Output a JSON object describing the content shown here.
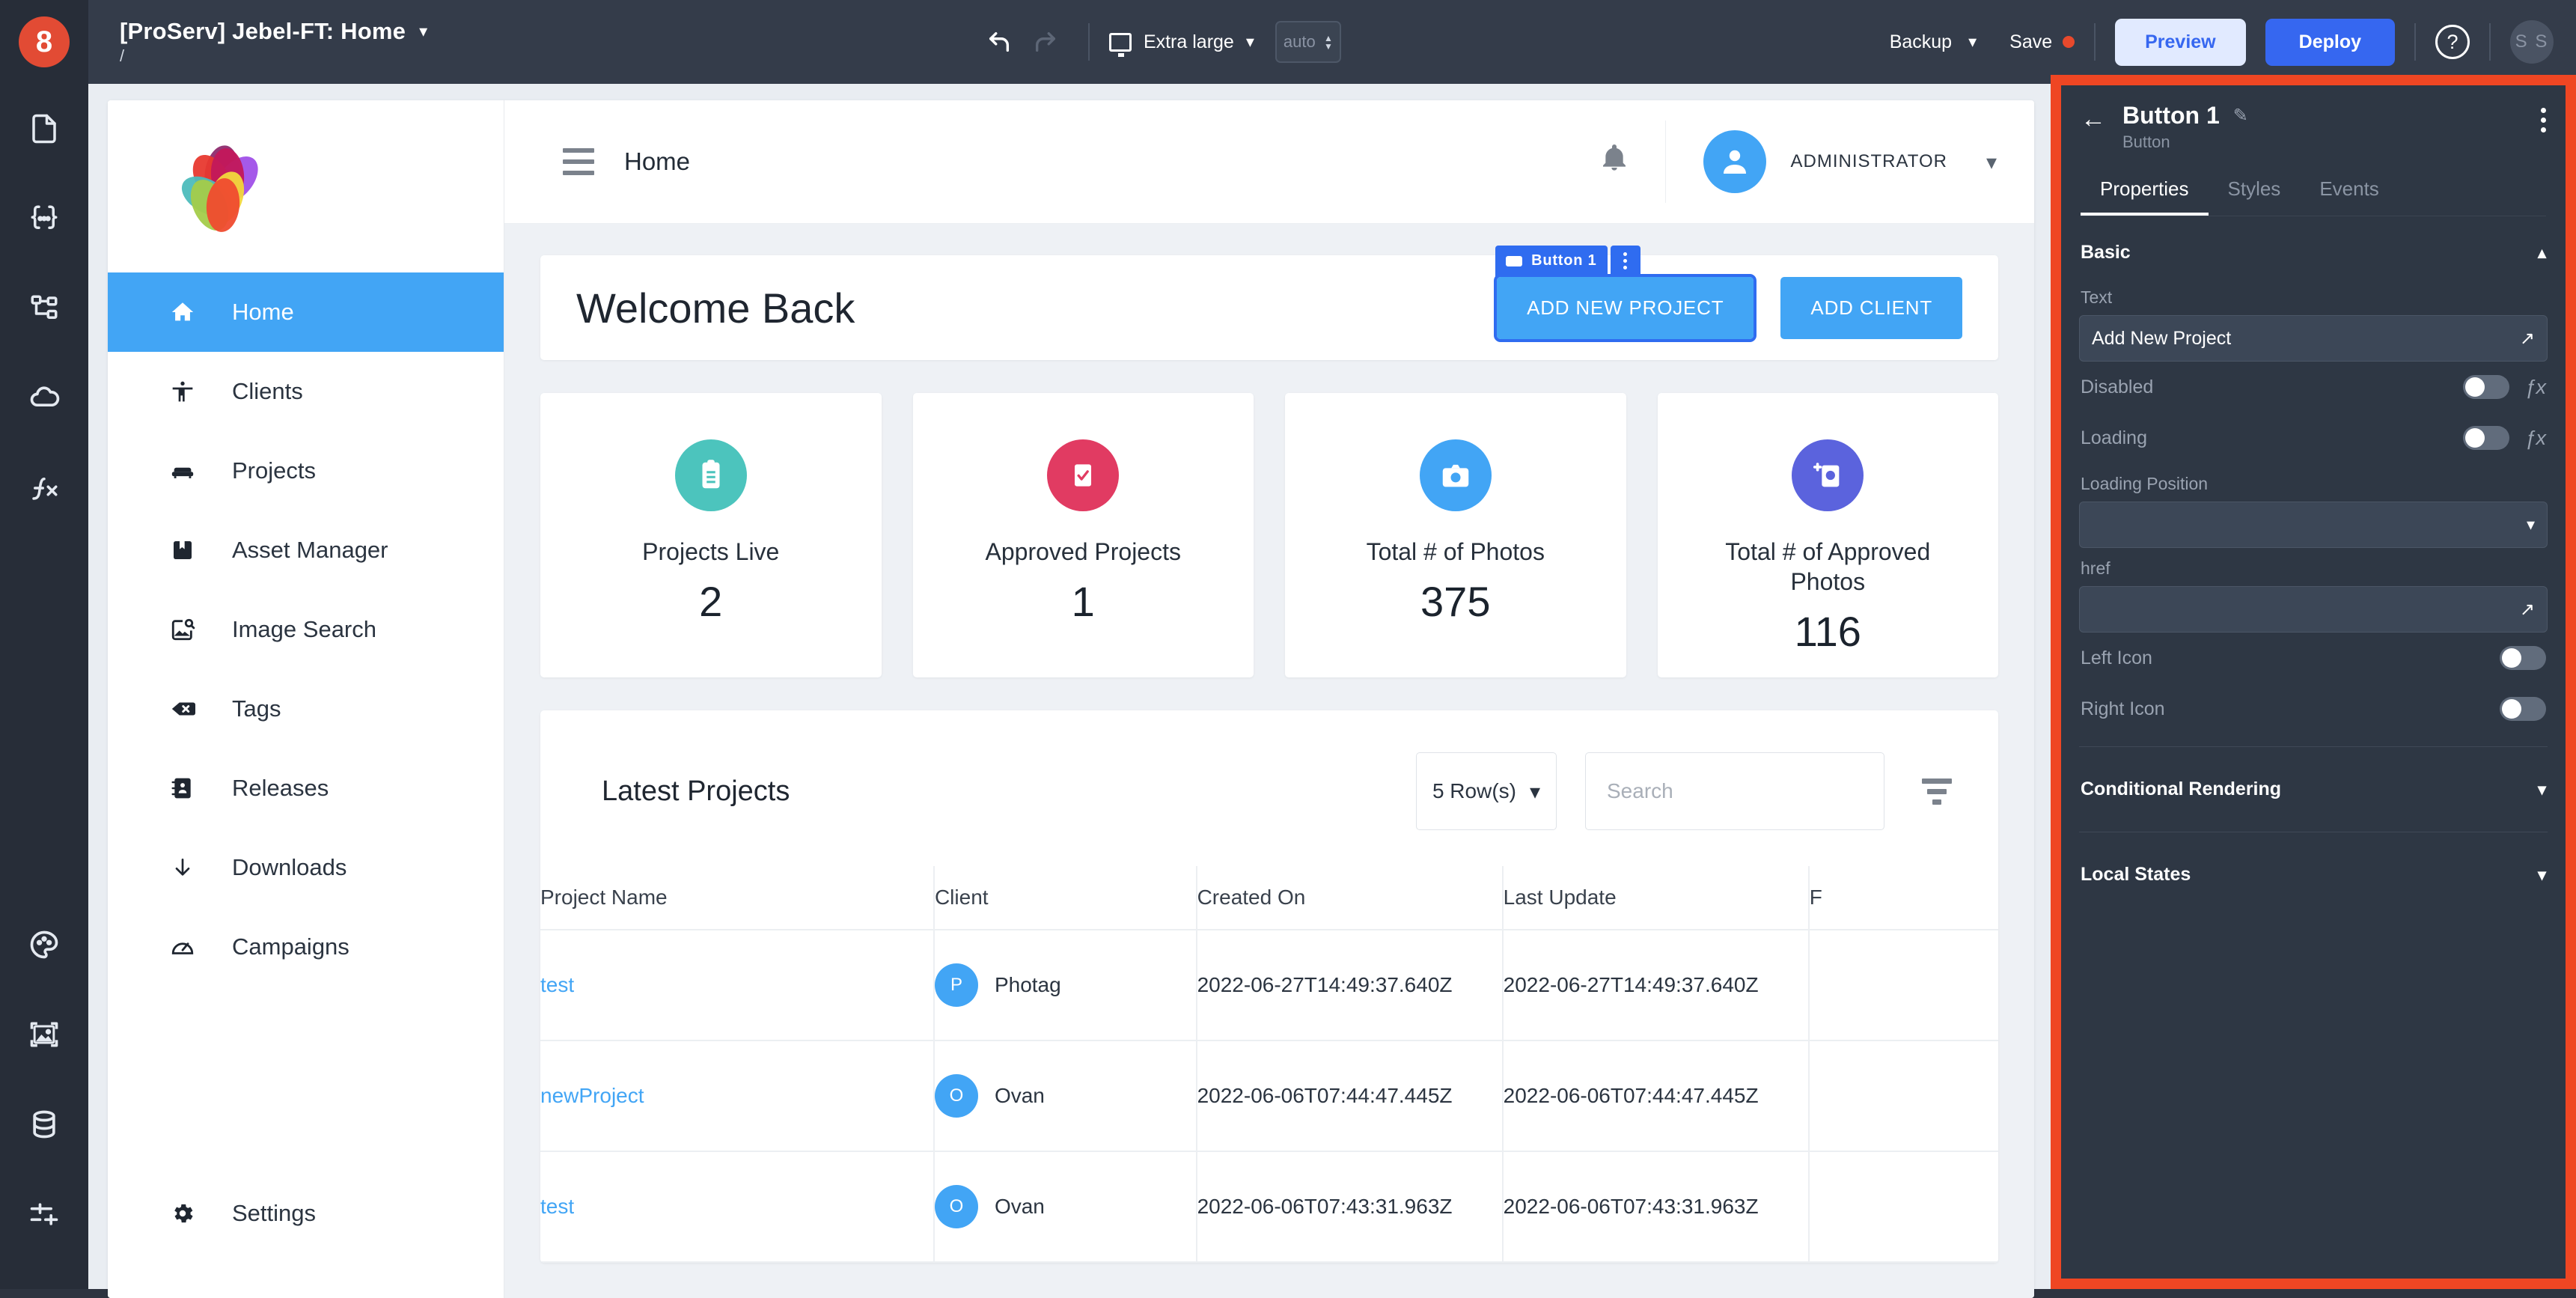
{
  "topbar": {
    "logo_text": "8",
    "app_title": "[ProServ] Jebel-FT: Home",
    "app_path": "/",
    "undo_icon": "undo-icon",
    "redo_icon": "redo-icon",
    "device_label": "Extra large",
    "zoom_value": "auto",
    "backup_label": "Backup",
    "save_label": "Save",
    "preview_label": "Preview",
    "deploy_label": "Deploy",
    "help_label": "?",
    "avatar_initials": "S S"
  },
  "rail": {
    "items": [
      {
        "icon": "page-icon"
      },
      {
        "icon": "braces-icon"
      },
      {
        "icon": "component-tree-icon"
      },
      {
        "icon": "cloud-icon"
      },
      {
        "icon": "fx-icon"
      }
    ],
    "bottom_items": [
      {
        "icon": "palette-icon"
      },
      {
        "icon": "image-icon"
      },
      {
        "icon": "database-icon"
      },
      {
        "icon": "sliders-icon"
      }
    ]
  },
  "app": {
    "sidebar": {
      "items": [
        {
          "label": "Home",
          "icon": "home-icon",
          "active": true
        },
        {
          "label": "Clients",
          "icon": "person-icon",
          "active": false
        },
        {
          "label": "Projects",
          "icon": "sofa-icon",
          "active": false
        },
        {
          "label": "Asset Manager",
          "icon": "book-icon",
          "active": false
        },
        {
          "label": "Image Search",
          "icon": "image-search-icon",
          "active": false
        },
        {
          "label": "Tags",
          "icon": "tag-x-icon",
          "active": false
        },
        {
          "label": "Releases",
          "icon": "contact-card-icon",
          "active": false
        },
        {
          "label": "Downloads",
          "icon": "download-arrow-icon",
          "active": false
        },
        {
          "label": "Campaigns",
          "icon": "gauge-icon",
          "active": false
        }
      ],
      "settings": {
        "label": "Settings",
        "icon": "gear-icon"
      }
    },
    "header": {
      "title": "Home",
      "menu_icon": "hamburger-icon",
      "bell_icon": "bell-icon",
      "user_name": "ADMINISTRATOR",
      "user_avatar_icon": "person-avatar-icon"
    },
    "welcome": {
      "heading": "Welcome Back",
      "primary_button": "ADD NEW PROJECT",
      "secondary_button": "ADD CLIENT",
      "selection_badge": "Button 1"
    },
    "stats": [
      {
        "label": "Projects Live",
        "value": "2",
        "color": "#4cc4bd",
        "icon": "clipboard-icon"
      },
      {
        "label": "Approved Projects",
        "value": "1",
        "color": "#e13b62",
        "icon": "check-box-icon"
      },
      {
        "label": "Total # of Photos",
        "value": "375",
        "color": "#42a5f5",
        "icon": "camera-icon"
      },
      {
        "label": "Total # of Approved Photos",
        "value": "116",
        "color": "#5b63dd",
        "icon": "camera-plus-icon"
      }
    ],
    "table": {
      "title": "Latest Projects",
      "rows_select": "5 Row(s)",
      "search_placeholder": "Search",
      "filter_icon": "filter-icon",
      "columns": [
        "Project Name",
        "Client",
        "Created On",
        "Last Update",
        "F"
      ],
      "rows": [
        {
          "project": "test",
          "client_initial": "P",
          "client": "Photag",
          "created": "2022-06-27T14:49:37.640Z",
          "updated": "2022-06-27T14:49:37.640Z"
        },
        {
          "project": "newProject",
          "client_initial": "O",
          "client": "Ovan",
          "created": "2022-06-06T07:44:47.445Z",
          "updated": "2022-06-06T07:44:47.445Z"
        },
        {
          "project": "test",
          "client_initial": "O",
          "client": "Ovan",
          "created": "2022-06-06T07:43:31.963Z",
          "updated": "2022-06-06T07:43:31.963Z"
        }
      ]
    }
  },
  "inspector": {
    "back_icon": "back-arrow-icon",
    "name": "Button 1",
    "type": "Button",
    "edit_icon": "pencil-icon",
    "kebab_icon": "more-vertical-icon",
    "tabs": [
      {
        "label": "Properties",
        "active": true
      },
      {
        "label": "Styles",
        "active": false
      },
      {
        "label": "Events",
        "active": false
      }
    ],
    "basic": {
      "heading": "Basic",
      "chevron": "chevron-up-icon",
      "text_label": "Text",
      "text_value": "Add New Project",
      "disabled_label": "Disabled",
      "disabled_value": "off",
      "loading_label": "Loading",
      "loading_value": "off",
      "loading_position_label": "Loading Position",
      "loading_position_value": "",
      "href_label": "href",
      "href_value": "",
      "left_icon_label": "Left Icon",
      "left_icon_value": "off",
      "right_icon_label": "Right Icon",
      "right_icon_value": "off",
      "fx_icon": "fx-icon",
      "expand_icon": "expand-diagonal-icon"
    },
    "conditional_rendering": {
      "heading": "Conditional Rendering",
      "chevron": "chevron-down-icon"
    },
    "local_states": {
      "heading": "Local States",
      "chevron": "chevron-down-icon"
    }
  },
  "colors": {
    "accent_blue": "#42a5f5",
    "deploy_blue": "#3667f0",
    "selection_blue": "#2f6cf0",
    "panel_highlight": "#ef4623",
    "logo_red": "#e24b34"
  }
}
